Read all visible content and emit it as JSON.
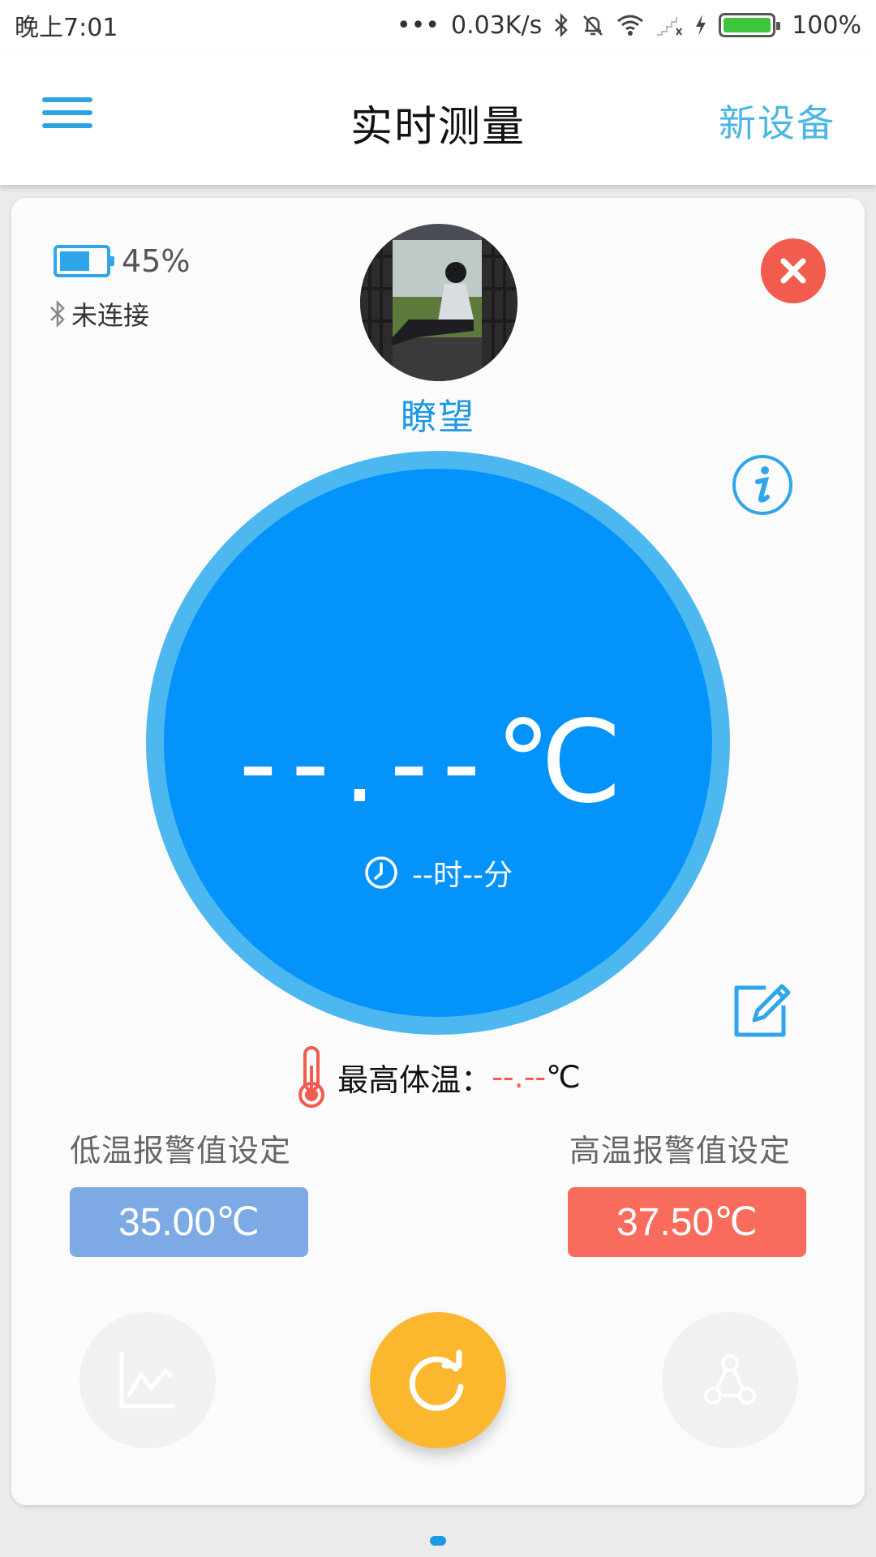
{
  "status_bar": {
    "time": "晚上7:01",
    "network_speed": "0.03K/s",
    "battery": "100%"
  },
  "app_bar": {
    "title": "实时测量",
    "new_device": "新设备"
  },
  "device": {
    "battery_pct": "45%",
    "bluetooth_status": "未连接",
    "user_name": "瞭望"
  },
  "measurement": {
    "temperature": "--.--℃",
    "time": "--时--分",
    "max_label": "最高体温：",
    "max_value": "--.--",
    "max_unit": "℃"
  },
  "alarms": {
    "low_label": "低温报警值设定",
    "low_value": "35.00℃",
    "high_label": "高温报警值设定",
    "high_value": "37.50℃"
  },
  "colors": {
    "accent": "#0493fb",
    "ring": "#4db8ef",
    "low_alarm": "#7daae4",
    "high_alarm": "#f96b5c",
    "refresh": "#fbb72e",
    "close": "#f25c4e"
  },
  "icons": [
    "menu-icon",
    "battery-icon",
    "bluetooth-icon",
    "close-icon",
    "info-icon",
    "clock-icon",
    "edit-icon",
    "thermometer-icon",
    "chart-icon",
    "refresh-icon",
    "share-icon"
  ]
}
